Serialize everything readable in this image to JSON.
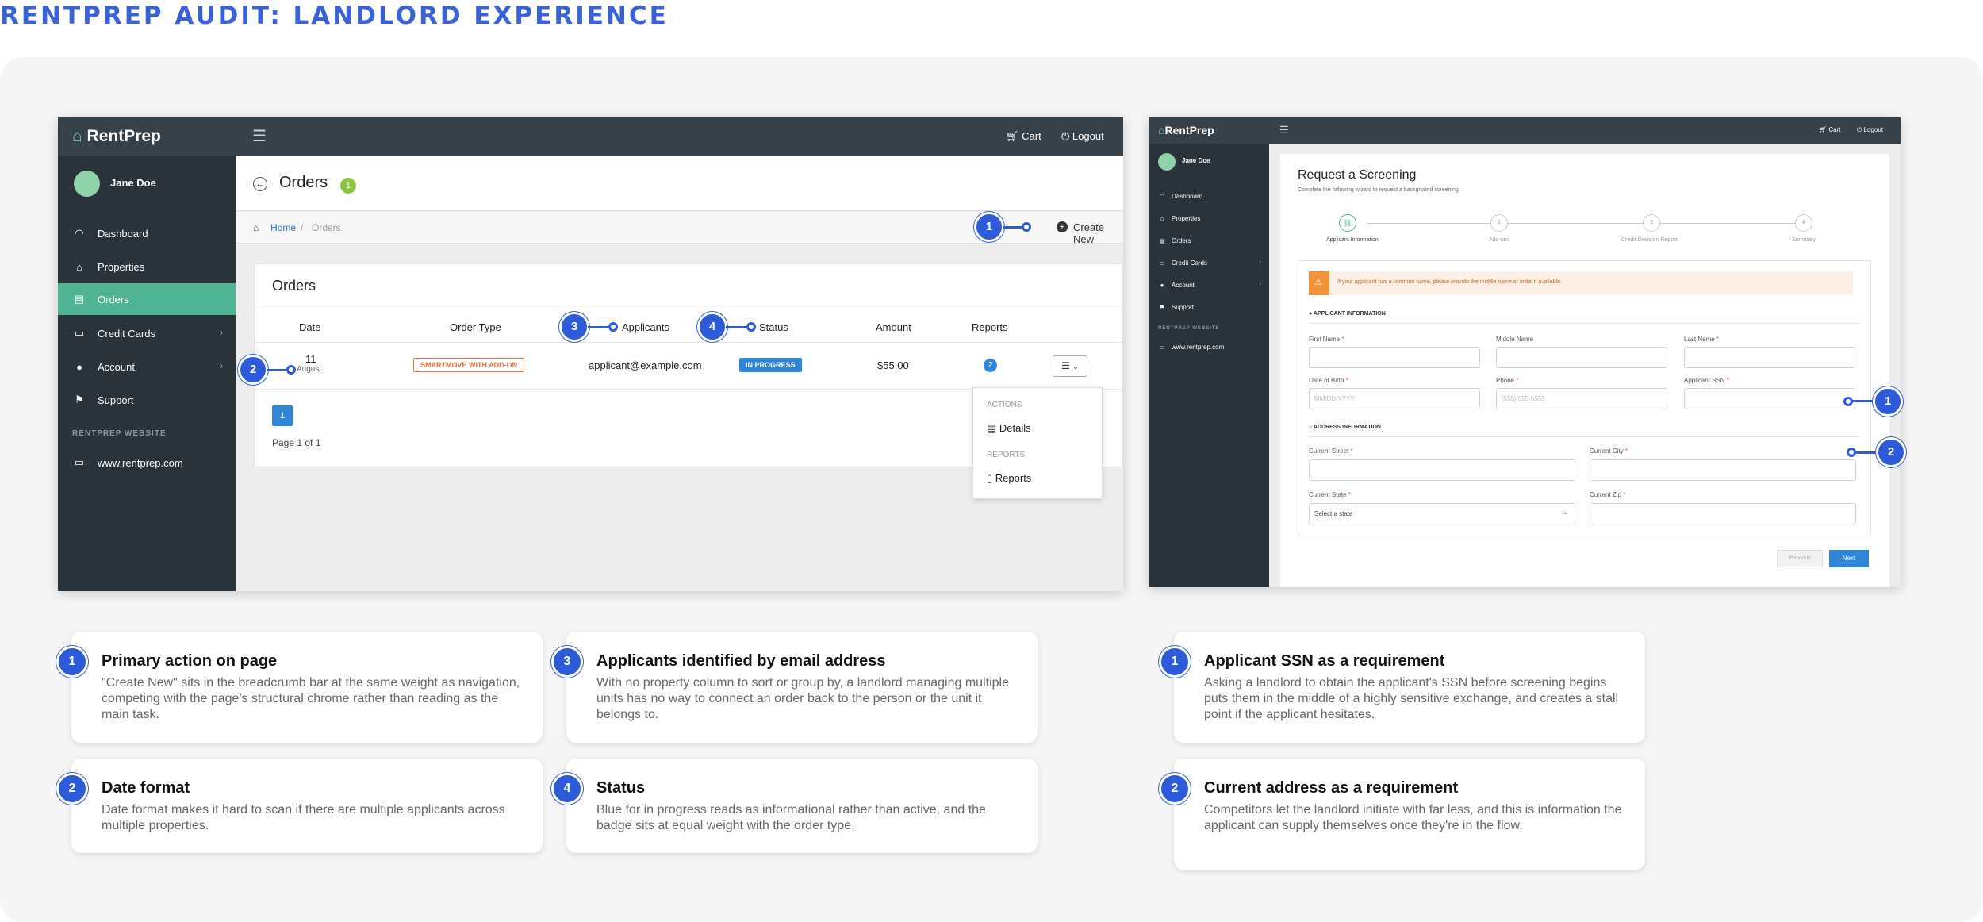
{
  "page_title": "RENTPREP AUDIT: LANDLORD EXPERIENCE",
  "colors": {
    "accent": "#2e5bd9",
    "sidebar": "#2b333a",
    "topbar": "#364149",
    "active_nav": "#4fb493",
    "status_badge": "#2f86d8",
    "order_type_badge": "#e0713f"
  },
  "left_shot": {
    "logo": "RentPrep",
    "topbar": {
      "cart": "Cart",
      "logout": "Logout",
      "menu_icon": "hamburger-icon"
    },
    "user": "Jane Doe",
    "nav": [
      {
        "label": "Dashboard",
        "icon": "gauge-icon"
      },
      {
        "label": "Properties",
        "icon": "home-icon"
      },
      {
        "label": "Orders",
        "icon": "document-icon"
      },
      {
        "label": "Credit Cards",
        "icon": "credit-card-icon"
      },
      {
        "label": "Account",
        "icon": "user-icon"
      },
      {
        "label": "Support",
        "icon": "flag-icon"
      }
    ],
    "website_label": "RENTPREP WEBSITE",
    "website_link": "www.rentprep.com",
    "page_heading": "Orders",
    "page_count": "1",
    "breadcrumb": {
      "home": "Home",
      "sep": "/",
      "current": "Orders"
    },
    "create_new": "Create New",
    "card_title": "Orders",
    "columns": [
      "Date",
      "Order Type",
      "Applicants",
      "Status",
      "Amount",
      "Reports"
    ],
    "row": {
      "day": "11",
      "month": "August",
      "order_type": "SMARTMOVE WITH ADD-ON",
      "applicant": "applicant@example.com",
      "status": "IN PROGRESS",
      "amount": "$55.00",
      "reports": "2"
    },
    "page_button": "1",
    "page_of": "Page 1 of 1",
    "dropdown": {
      "actions_label": "ACTIONS",
      "details": "Details",
      "reports_label": "REPORTS",
      "reports": "Reports"
    }
  },
  "right_shot": {
    "logo": "RentPrep",
    "topbar": {
      "cart": "Cart",
      "logout": "Logout"
    },
    "user": "Jane Doe",
    "nav": [
      "Dashboard",
      "Properties",
      "Orders",
      "Credit Cards",
      "Account",
      "Support"
    ],
    "website_label": "RENTPREP WEBSITE",
    "website_link": "www.rentprep.com",
    "heading": "Request a Screening",
    "subheading": "Complete the following wizard to request a background screening.",
    "steps": [
      {
        "num": "",
        "label": "Applicant Information"
      },
      {
        "num": "2",
        "label": "Add-ons"
      },
      {
        "num": "3",
        "label": "Credit Decision Report"
      },
      {
        "num": "4",
        "label": "Summary"
      }
    ],
    "warning": "If your applicant has a common name, please provide the middle name or initial if available.",
    "applicant_section": "APPLICANT INFORMATION",
    "first_name": "First Name",
    "middle_name": "Middle Name",
    "last_name": "Last Name",
    "dob": "Date of Birth",
    "dob_placeholder": "MM/DD/YYYY",
    "phone": "Phone",
    "phone_placeholder": "(555) 555-5555",
    "ssn": "Applicant SSN",
    "address_section": "ADDRESS INFORMATION",
    "street": "Current Street",
    "city": "Current City",
    "state": "Current State",
    "state_placeholder": "Select a state",
    "zip": "Current Zip",
    "required_mark": "*",
    "previous": "Previous",
    "next": "Next"
  },
  "markers": {
    "left": [
      "1",
      "2",
      "3",
      "4"
    ],
    "right": [
      "1",
      "2"
    ]
  },
  "notes_left": [
    {
      "num": "1",
      "title": "Primary action on page",
      "body": "\"Create New\" sits in the breadcrumb bar at the same weight as navigation, competing with the page's structural chrome rather than reading as the main task."
    },
    {
      "num": "3",
      "title": "Applicants identified by email address",
      "body": "With no property column to sort or group by, a landlord managing multiple units has no way to connect an order back to the person or the unit it belongs to."
    },
    {
      "num": "2",
      "title": "Date format",
      "body": "Date format makes it hard to scan if there are multiple applicants across multiple properties."
    },
    {
      "num": "4",
      "title": "Status",
      "body": "Blue for in progress reads as informational rather than active, and the badge sits at equal weight with the order type."
    }
  ],
  "notes_right": [
    {
      "num": "1",
      "title": "Applicant SSN as a requirement",
      "body": "Asking a landlord to obtain the applicant's SSN before screening begins puts them in the middle of a highly sensitive exchange, and creates a stall point if the applicant hesitates."
    },
    {
      "num": "2",
      "title": "Current address as a requirement",
      "body": "Competitors let the landlord initiate with far less, and this is information the applicant can supply themselves once they're in the flow."
    }
  ]
}
